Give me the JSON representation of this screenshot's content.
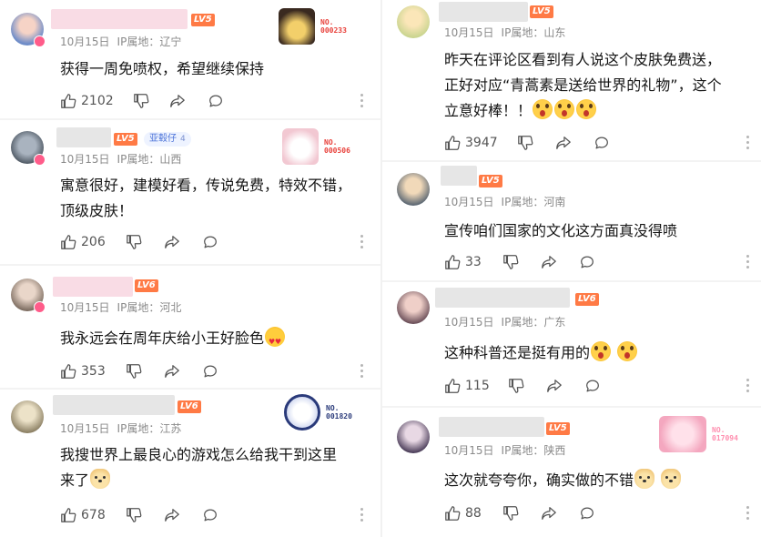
{
  "comments": [
    {
      "date": "10月15日",
      "ip": "IP属地：辽宁",
      "level": "LV5",
      "text": "获得一周免喷权，希望继续保持",
      "emojis": [],
      "likes": "2102",
      "deco_no": "NO.\n000233",
      "deco_color": "#e8403a"
    },
    {
      "date": "10月15日",
      "ip": "IP属地：山西",
      "level": "LV5",
      "tag": "亚毂仔",
      "tag_num": "4",
      "text_lines": [
        "寓意很好，建模好看，传说免费，特效不错，",
        "顶级皮肤！"
      ],
      "likes": "206",
      "deco_no": "NO.\n000506",
      "deco_color": "#e8403a"
    },
    {
      "date": "10月15日",
      "ip": "IP属地：河北",
      "level": "LV6",
      "text": "我永远会在周年庆给小王好脸色",
      "emojis": [
        "heart-eyes-emoji"
      ],
      "likes": "353"
    },
    {
      "date": "10月15日",
      "ip": "IP属地：江苏",
      "level": "LV6",
      "text_lines": [
        "我搜世界上最良心的游戏怎么给我干到这里",
        "来了"
      ],
      "emojis": [
        "doge-emoji"
      ],
      "likes": "678",
      "deco_no": "NO.\n001820",
      "deco_color": "#2a3a7a"
    },
    {
      "date": "10月15日",
      "ip": "IP属地：山东",
      "level": "LV5",
      "text_lines": [
        "昨天在评论区看到有人说这个皮肤免费送，",
        "正好对应“青蒿素是送给世界的礼物”，这个",
        "立意好棒！！"
      ],
      "emojis": [
        "shocked-emoji",
        "shocked-emoji",
        "shocked-emoji"
      ],
      "likes": "3947"
    },
    {
      "date": "10月15日",
      "ip": "IP属地：河南",
      "level": "LV5",
      "text": "宣传咱们国家的文化这方面真没得喷",
      "likes": "33"
    },
    {
      "date": "10月15日",
      "ip": "IP属地：广东",
      "level": "LV6",
      "text": "这种科普还是挺有用的",
      "emojis": [
        "shocked-emoji",
        "shocked-emoji"
      ],
      "likes": "115"
    },
    {
      "date": "10月15日",
      "ip": "IP属地：陕西",
      "level": "LV5",
      "text": "这次就夸夸你，确实做的不错",
      "emojis": [
        "doge-emoji",
        "doge-emoji"
      ],
      "likes": "88",
      "deco_no": "NO.\n017094",
      "deco_color": "#ff8fb0"
    }
  ]
}
